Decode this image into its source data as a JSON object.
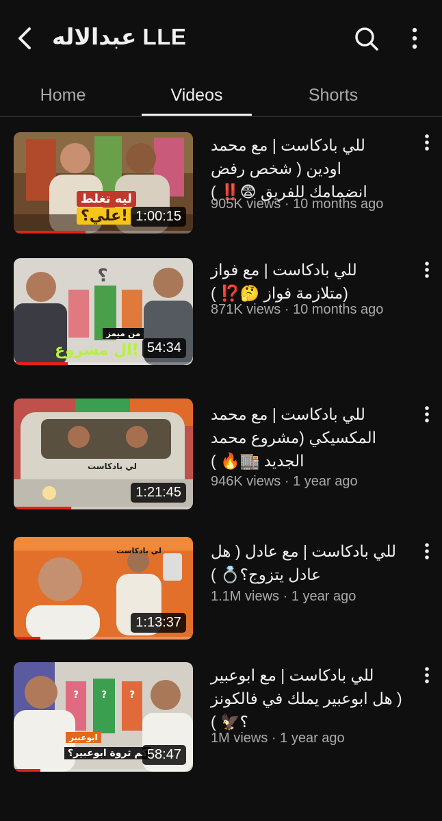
{
  "header": {
    "title": "عبدالاله LLE",
    "back_icon": "back-arrow-icon",
    "search_icon": "search-icon",
    "more_icon": "more-vertical-icon"
  },
  "tabs": [
    {
      "label": "Home",
      "active": false
    },
    {
      "label": "Videos",
      "active": true
    },
    {
      "label": "Shorts",
      "active": false
    }
  ],
  "videos": [
    {
      "title_lines": [
        "للي بادكاست | مع محمد",
        "اودين ( شخص رفض",
        "انضمامك للفريق 😨‼️ )"
      ],
      "views": "905K views",
      "age": "10 months ago",
      "duration": "1:00:15",
      "thumb_text": [
        "ليه تغلط",
        "علي؟!"
      ],
      "watched_fraction": 0.4
    },
    {
      "title_lines": [
        "للي بادكاست | مع فواز",
        "(متلازمة فواز 🤔⁉️ )"
      ],
      "views": "871K views",
      "age": "10 months ago",
      "duration": "54:34",
      "thumb_text": [
        "من ميمز",
        "ال مشروع!"
      ],
      "watched_fraction": 0.3
    },
    {
      "title_lines": [
        "للي بادكاست | مع محمد",
        "المكسيكي (مشروع محمد",
        "الجديد 🏬🔥 )"
      ],
      "views": "946K views",
      "age": "1 year ago",
      "duration": "1:21:45",
      "thumb_text": [
        "لي بادكاست"
      ],
      "watched_fraction": 0.32
    },
    {
      "title_lines": [
        "للي بادكاست | مع عادل ( هل",
        "عادل يتزوج؟💍 )"
      ],
      "views": "1.1M views",
      "age": "1 year ago",
      "duration": "1:13:37",
      "thumb_text": [
        "لي بادكاست"
      ],
      "watched_fraction": 0.15
    },
    {
      "title_lines": [
        "للي بادكاست | مع ابوعبير",
        "( هل ابوعبير يملك في فالكونز",
        "؟🦅 )"
      ],
      "views": "1M views",
      "age": "1 year ago",
      "duration": "58:47",
      "thumb_text": [
        "ابوعبير",
        "كم ثروة ابوعبير؟"
      ],
      "watched_fraction": 0.15
    }
  ]
}
